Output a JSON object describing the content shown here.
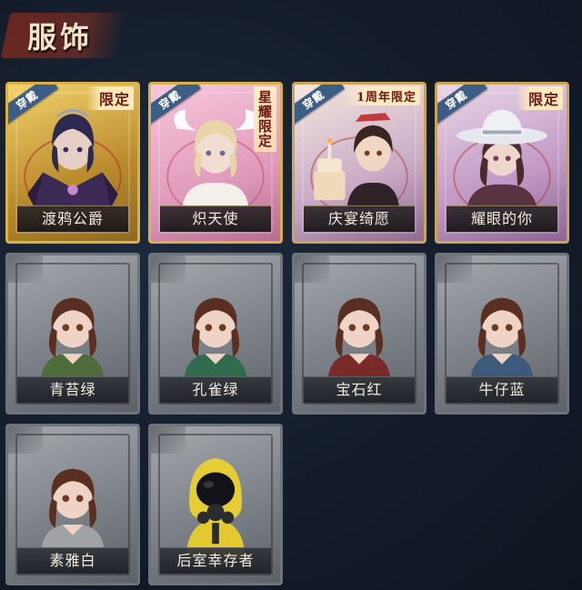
{
  "section": {
    "title": "服饰"
  },
  "equipped_label": "穿戴",
  "cards": [
    {
      "name": "渡鸦公爵",
      "badge": "限定",
      "equipped": true,
      "theme": "gold",
      "icon": "raven-duke-portrait-icon"
    },
    {
      "name": "炽天使",
      "badge": "星耀限定",
      "equipped": true,
      "theme": "pink",
      "icon": "seraph-portrait-icon"
    },
    {
      "name": "庆宴绮愿",
      "badge": "1周年限定",
      "equipped": true,
      "theme": "cream",
      "icon": "anniversary-feast-portrait-icon"
    },
    {
      "name": "耀眼的你",
      "badge": "限定",
      "equipped": true,
      "theme": "lilac",
      "icon": "cowgirl-portrait-icon"
    },
    {
      "name": "青苔绿",
      "theme": "stone",
      "icon": "girl-moss-green-portrait-icon",
      "accent": "#4e6b3a"
    },
    {
      "name": "孔雀绿",
      "theme": "stone",
      "icon": "girl-peacock-green-portrait-icon",
      "accent": "#2f6b4c"
    },
    {
      "name": "宝石红",
      "theme": "stone",
      "icon": "girl-ruby-red-portrait-icon",
      "accent": "#7a2a28"
    },
    {
      "name": "牛仔蓝",
      "theme": "stone",
      "icon": "girl-denim-blue-portrait-icon",
      "accent": "#3d5a7a"
    },
    {
      "name": "素雅白",
      "theme": "stone",
      "icon": "girl-plain-white-portrait-icon",
      "accent": "#9fa3a6"
    },
    {
      "name": "后室幸存者",
      "theme": "stone",
      "icon": "backrooms-survivor-portrait-icon",
      "accent": "#e4c830"
    }
  ]
}
